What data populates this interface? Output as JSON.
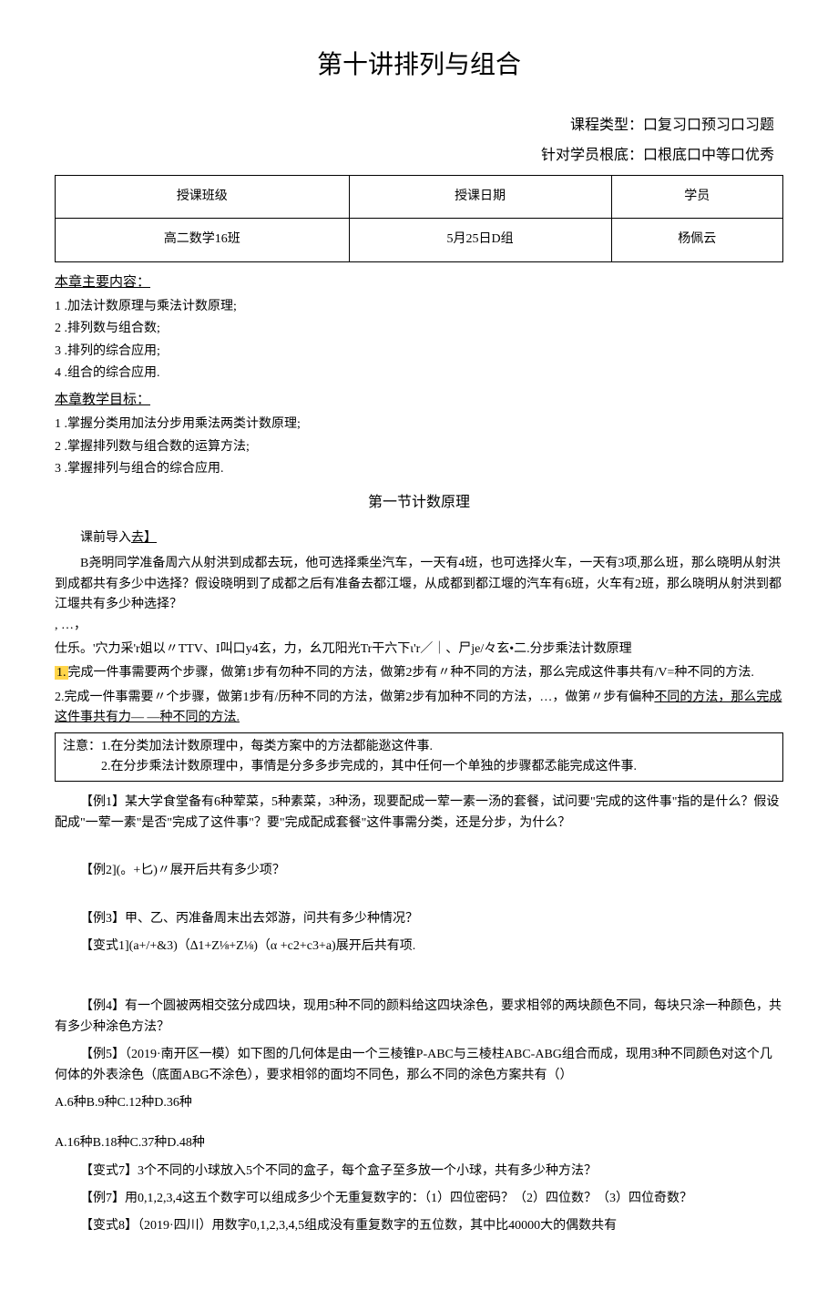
{
  "title": "第十讲排列与组合",
  "meta": {
    "course_type_label": "课程类型：口复习口预习口习题",
    "student_basis_label": "针对学员根底：口根底口中等口优秀"
  },
  "table": {
    "headers": [
      "授课班级",
      "授课日期",
      "学员"
    ],
    "row": [
      "高二数学16班",
      "5月25日D组",
      "杨佩云"
    ]
  },
  "content_heading": "本章主要内容：",
  "content_items": [
    "1  .加法计数原理与乘法计数原理;",
    "2  .排列数与组合数;",
    "3  .排列的综合应用;",
    "4  .组合的综合应用."
  ],
  "goal_heading": "本章教学目标：",
  "goal_items": [
    "1  .掌握分类用加法分步用乘法两类计数原理;",
    "2  .掌握排列数与组合数的运算方法;",
    "3  .掌握排列与组合的综合应用."
  ],
  "section1_title": "第一节计数原理",
  "import_label": "课前导入",
  "import_suffix": "去】",
  "import_p1": "B尧明同学准备周六从射洪到成都去玩，他可选择乘坐汽车，一天有4班，也可选择火车，一天有3项,那么班，那么晓明从射洪到成都共有多少中选择？假设晓明到了成都之后有准备去都江堰，从成都到都江堰的汽车有6班，火车有2班，那么晓明从射洪到都江堰共有多少种选择？",
  "import_dots": " ,  …，",
  "import_p2": "仕乐。'穴力采'r姐以〃TTV、I叫口y4玄，力，幺兀阳光Tr干六下ι'r／｜、尸je/々玄•二.分步乘法计数原理",
  "step1_hl": "1.",
  "step1_text": "完成一件事需要两个步骤，做第1步有勿种不同的方法，做第2步有〃种不同的方法，那么完成这件事共有/V=种不同的方法.",
  "step2_text_a": "2.完成一件事需要〃个步骤，做第1步有/历种不同的方法，做第2步有加种不同的方法，…，做第〃步有偏种",
  "step2_underline": "不同的方法，那么完成这件事共有力—                              —种不同的方法.",
  "note_line1": "注意：1.在分类加法计数原理中，每类方案中的方法都能逖这件事.",
  "note_line2": "2.在分步乘法计数原理中，事情是分多多步完成的，其中任何一个单独的步骤都孞能完成这件事.",
  "ex1": "【例1】某大学食堂备有6种荤菜，5种素菜，3种汤，现要配成一荤一素一汤的套餐，试问要\"完成的这件事\"指的是什么？假设配成\"一荤一素\"是否\"完成了这件事\"？要\"完成配成套餐\"这件事需分类，还是分步，为什么？",
  "ex2": "【例2](。+匕)〃展开后共有多少项？",
  "ex3": "【例3】甲、乙、丙准备周末出去郊游，问共有多少种情况？",
  "var1": "【变式1](a+/+&3)（∆1+Z⅛+Z⅛)（α +c2+c3+a)展开后共有项.",
  "ex4": "【例4】有一个圆被两相交弦分成四块，现用5种不同的颜料给这四块涂色，要求相邻的两块颜色不同，每块只涂一种颜色，共有多少种涂色方法？",
  "ex5": "【例5】（2019·南开区一模）如下图的几何体是由一个三棱锥P-ABC与三棱柱ABC-ABG组合而成，现用3种不同颜色对这个几何体的外表涂色（底面ABG不涂色），要求相邻的面均不同色，那么不同的涂色方案共有（）",
  "ex5_choices": "A.6种B.9种C.12种D.36种",
  "ex5b_choices": "A.16种B.18种C.37种D.48种",
  "var7": "【变式7】3个不同的小球放入5个不同的盒子，每个盒子至多放一个小球，共有多少种方法？",
  "ex7": "【例7】用0,1,2,3,4这五个数字可以组成多少个无重复数字的：（1）四位密码？（2）四位数？（3）四位奇数？",
  "var8": "【变式8】（2019·四川）用数字0,1,2,3,4,5组成没有重复数字的五位数，其中比40000大的偶数共有"
}
